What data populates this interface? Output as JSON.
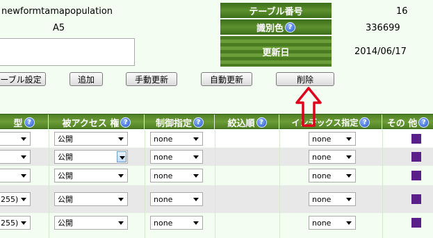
{
  "header": {
    "table_name": "newformtamapopulation",
    "table_code": "A5",
    "table_number_label": "テーブル番号",
    "table_number_value": "16",
    "id_color_label": "識別色",
    "id_color_value": "336699",
    "updated_label": "更新日",
    "updated_value": "2014/06/17"
  },
  "toolbar": {
    "settings_label": "ーブル設定",
    "add_label": "追加",
    "manual_update_label": "手動更新",
    "auto_update_label": "自動更新",
    "delete_label": "削除"
  },
  "columns": {
    "type": "型",
    "access": "被アクセス 権",
    "control": "制御指定",
    "narrow": "絞込順",
    "index": "インデックス指定",
    "other": "その 他"
  },
  "help_glyph": "?",
  "rows": [
    {
      "type": "",
      "access": "公開",
      "control": "none",
      "index": "none"
    },
    {
      "type": "",
      "access": "公開",
      "control": "none",
      "index": "none"
    },
    {
      "type": "",
      "access": "公開",
      "control": "none",
      "index": "none"
    },
    {
      "type": "255)",
      "access": "公開",
      "control": "none",
      "index": "none"
    },
    {
      "type": "255)",
      "access": "公開",
      "control": "none",
      "index": "none"
    }
  ],
  "colors": {
    "accent_green": "#5e912f",
    "annotation_red": "#e0001b",
    "other_square": "#5b1f8a"
  }
}
